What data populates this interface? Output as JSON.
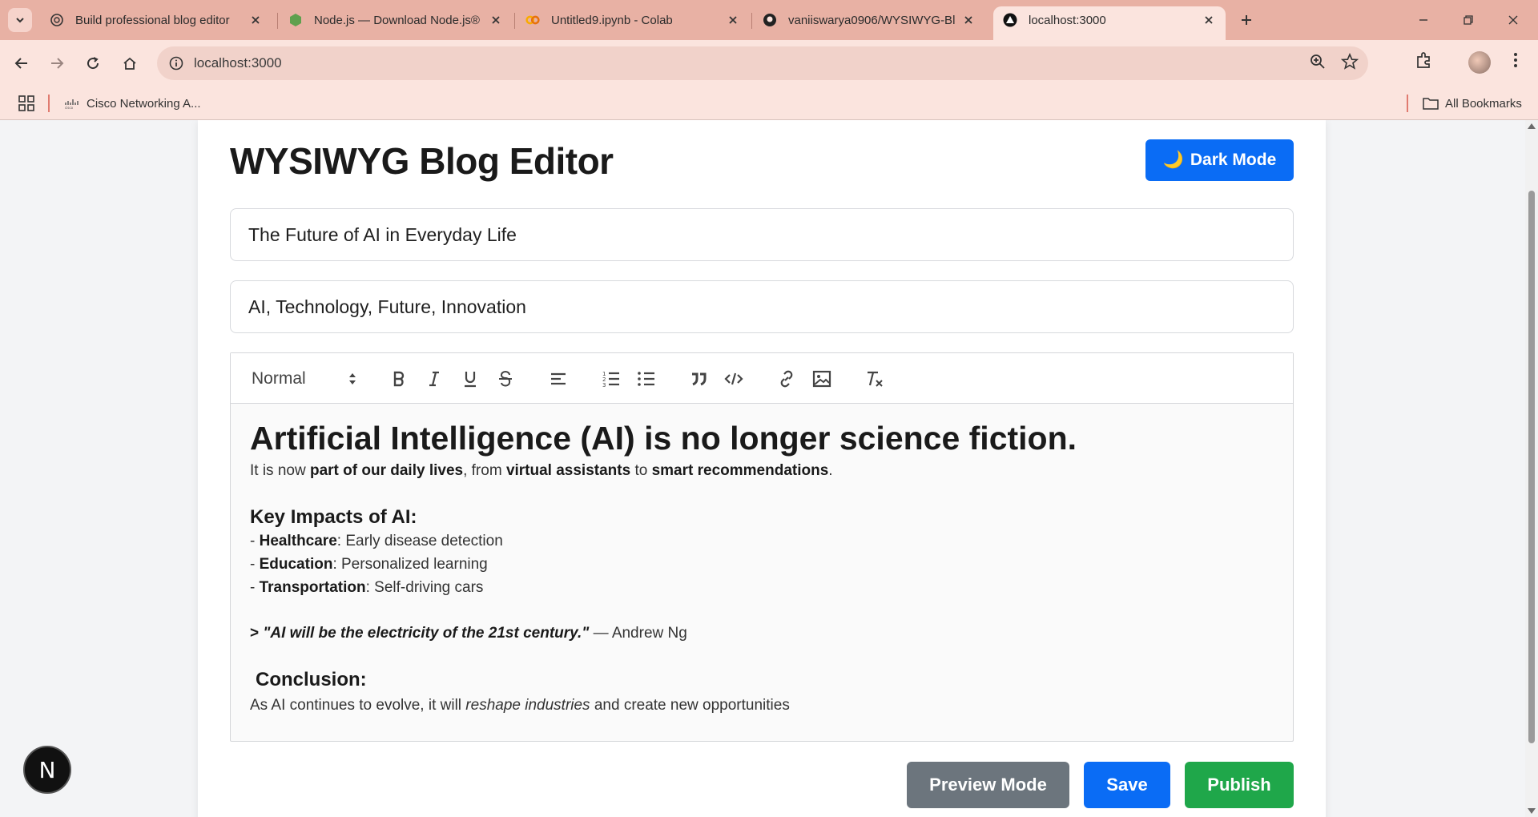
{
  "browser": {
    "tabs": [
      {
        "title": "Build professional blog editor",
        "icon": "chatgpt-icon"
      },
      {
        "title": "Node.js — Download Node.js®",
        "icon": "nodejs-icon"
      },
      {
        "title": "Untitled9.ipynb - Colab",
        "icon": "colab-icon"
      },
      {
        "title": "vaniiswarya0906/WYSIWYG-Blo",
        "icon": "github-icon"
      },
      {
        "title": "localhost:3000",
        "icon": "nextjs-icon",
        "active": true
      }
    ],
    "url": "localhost:3000",
    "bookmarks": [
      {
        "label": "Cisco Networking A...",
        "icon": "cisco-icon"
      }
    ],
    "all_bookmarks_label": "All Bookmarks"
  },
  "page": {
    "title": "WYSIWYG Blog Editor",
    "dark_mode_label": "Dark Mode",
    "dark_mode_emoji": "🌙",
    "post_title_value": "The Future of AI in Everyday Life",
    "tags_value": "AI, Technology, Future, Innovation",
    "editor": {
      "header_format": "Normal",
      "heading": "Artificial Intelligence (AI) is no longer science fiction.",
      "intro": {
        "p1": "It is now ",
        "b1": "part of our daily lives",
        "p2": ", from ",
        "b2": "virtual assistants",
        "p3": " to ",
        "b3": "smart recommendations",
        "p4": "."
      },
      "impacts_heading": "Key Impacts of AI:",
      "impacts": [
        {
          "prefix": "- ",
          "label": "Healthcare",
          "text": ": Early disease detection"
        },
        {
          "prefix": "- ",
          "label": "Education",
          "text": ": Personalized learning"
        },
        {
          "prefix": "- ",
          "label": "Transportation",
          "text": ": Self-driving cars"
        }
      ],
      "quote": {
        "prefix": "> ",
        "text": "\"AI will be the electricity of the 21st century.\"",
        "author": " — Andrew Ng"
      },
      "conclusion_heading": "Conclusion:",
      "conclusion": {
        "p1": "As AI continues to evolve, it will ",
        "em": "reshape industries",
        "p2": " and create new opportunities"
      }
    },
    "buttons": {
      "preview": "Preview Mode",
      "save": "Save",
      "publish": "Publish"
    },
    "colors": {
      "primary": "#0a6cf5",
      "preview": "#6c757d",
      "publish": "#1fa74a"
    },
    "dev_badge": "N"
  }
}
